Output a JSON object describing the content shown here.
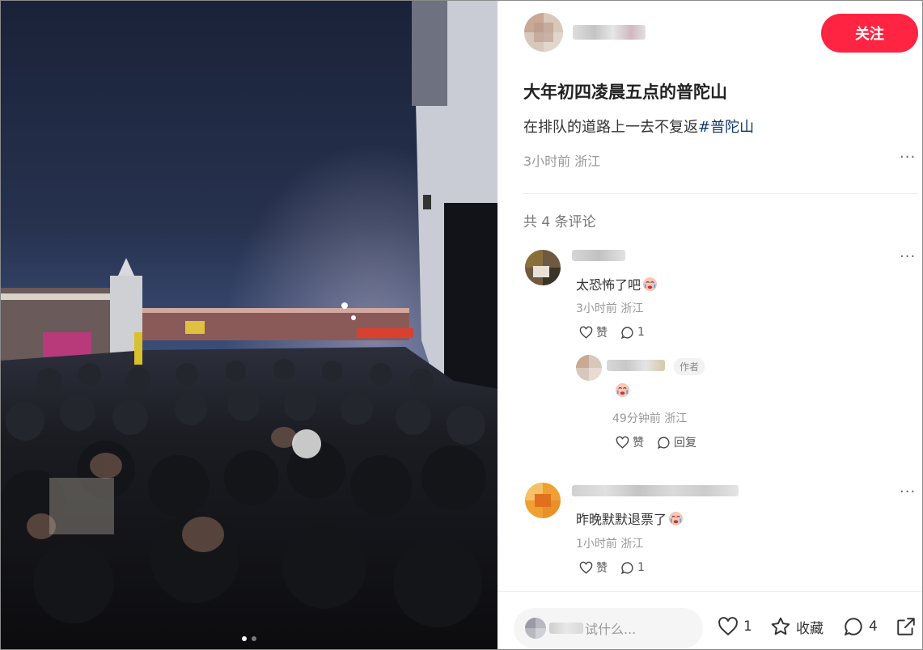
{
  "post": {
    "title": "大年初四凌晨五点的普陀山",
    "desc_text": "在排队的道路上一去不复返",
    "desc_tag": "#普陀山",
    "time": "3小时前",
    "location": "浙江",
    "more_label": "···"
  },
  "follow_label": "关注",
  "comments_summary": "共 4 条评论",
  "comments": [
    {
      "text": "太恐怖了吧",
      "emoji": "crying-face-icon",
      "time": "3小时前",
      "location": "浙江",
      "like_label": "赞",
      "reply_count": "1"
    },
    {
      "text": "昨晚默默退票了",
      "emoji": "crying-face-icon",
      "time": "1小时前",
      "location": "浙江",
      "like_label": "赞",
      "reply_count": "1"
    }
  ],
  "reply": {
    "author_tag": "作者",
    "emoji": "crying-face-icon",
    "time": "49分钟前",
    "location": "浙江",
    "like_label": "赞",
    "reply_label": "回复"
  },
  "bottom": {
    "input_placeholder": "试什么...",
    "like_count": "1",
    "collect_label": "收藏",
    "comment_count": "4"
  },
  "carousel": {
    "total": 2,
    "active": 1
  },
  "colors": {
    "accent": "#ff2442",
    "tag": "#13386c",
    "muted": "#999999"
  }
}
